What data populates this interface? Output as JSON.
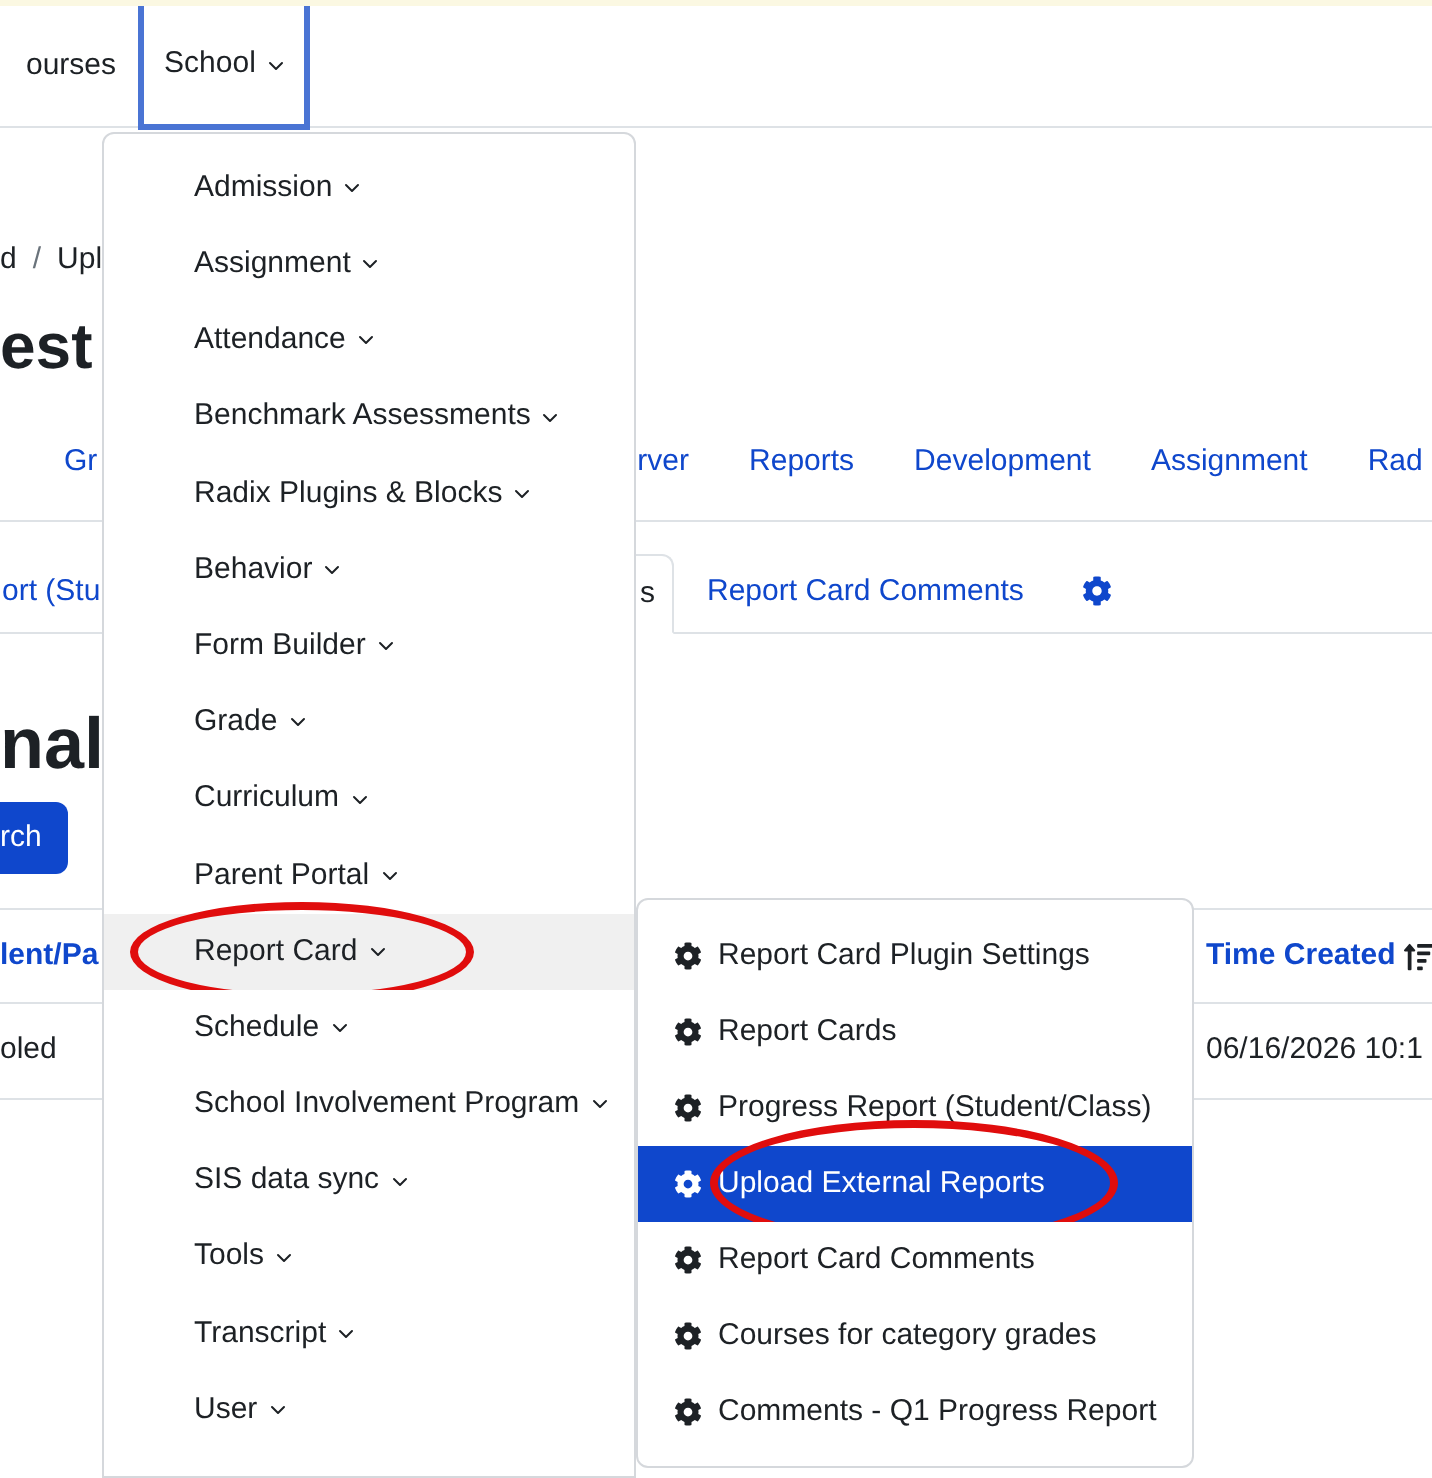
{
  "navbar": {
    "items": [
      {
        "label": "ourses",
        "selected": false,
        "kind": "link"
      },
      {
        "label": "School",
        "selected": true,
        "kind": "dropdown"
      }
    ]
  },
  "breadcrumb": {
    "items": [
      "d",
      "Upl"
    ],
    "separator": "/"
  },
  "page_title": "est",
  "secondary_nav": [
    "Gr",
    "rver",
    "Reports",
    "Development",
    "Assignment",
    "Rad"
  ],
  "tabs": [
    {
      "label": "ort (Stu",
      "selected": false
    },
    {
      "label": "s",
      "selected": true
    },
    {
      "label": "Report Card Comments",
      "selected": false
    }
  ],
  "section_title": "nal",
  "search_button": "rch",
  "table": {
    "columns": [
      "lent/Pa",
      "Time Created"
    ],
    "rows": [
      [
        "oled",
        "06/16/2026 10:1"
      ]
    ]
  },
  "school_menu": {
    "items": [
      {
        "label": "Admission",
        "selected": false,
        "circled": false
      },
      {
        "label": "Assignment",
        "selected": false,
        "circled": false
      },
      {
        "label": "Attendance",
        "selected": false,
        "circled": false
      },
      {
        "label": "Benchmark Assessments",
        "selected": false,
        "circled": false
      },
      {
        "label": "Radix Plugins & Blocks",
        "selected": false,
        "circled": false
      },
      {
        "label": "Behavior",
        "selected": false,
        "circled": false
      },
      {
        "label": "Form Builder",
        "selected": false,
        "circled": false
      },
      {
        "label": "Grade",
        "selected": false,
        "circled": false
      },
      {
        "label": "Curriculum",
        "selected": false,
        "circled": false
      },
      {
        "label": "Parent Portal",
        "selected": false,
        "circled": false
      },
      {
        "label": "Report Card",
        "selected": true,
        "circled": true
      },
      {
        "label": "Schedule",
        "selected": false,
        "circled": false
      },
      {
        "label": "School Involvement Program",
        "selected": false,
        "circled": false
      },
      {
        "label": "SIS data sync",
        "selected": false,
        "circled": false
      },
      {
        "label": "Tools",
        "selected": false,
        "circled": false
      },
      {
        "label": "Transcript",
        "selected": false,
        "circled": false
      },
      {
        "label": "User",
        "selected": false,
        "circled": false
      }
    ]
  },
  "report_card_submenu": {
    "items": [
      {
        "label": "Report Card Plugin Settings",
        "selected": false,
        "circled": false
      },
      {
        "label": "Report Cards",
        "selected": false,
        "circled": false
      },
      {
        "label": "Progress Report (Student/Class)",
        "selected": false,
        "circled": false
      },
      {
        "label": "Upload External Reports",
        "selected": true,
        "circled": true
      },
      {
        "label": "Report Card Comments",
        "selected": false,
        "circled": false
      },
      {
        "label": "Courses for category grades",
        "selected": false,
        "circled": false
      },
      {
        "label": "Comments - Q1 Progress Report",
        "selected": false,
        "circled": false
      }
    ]
  }
}
